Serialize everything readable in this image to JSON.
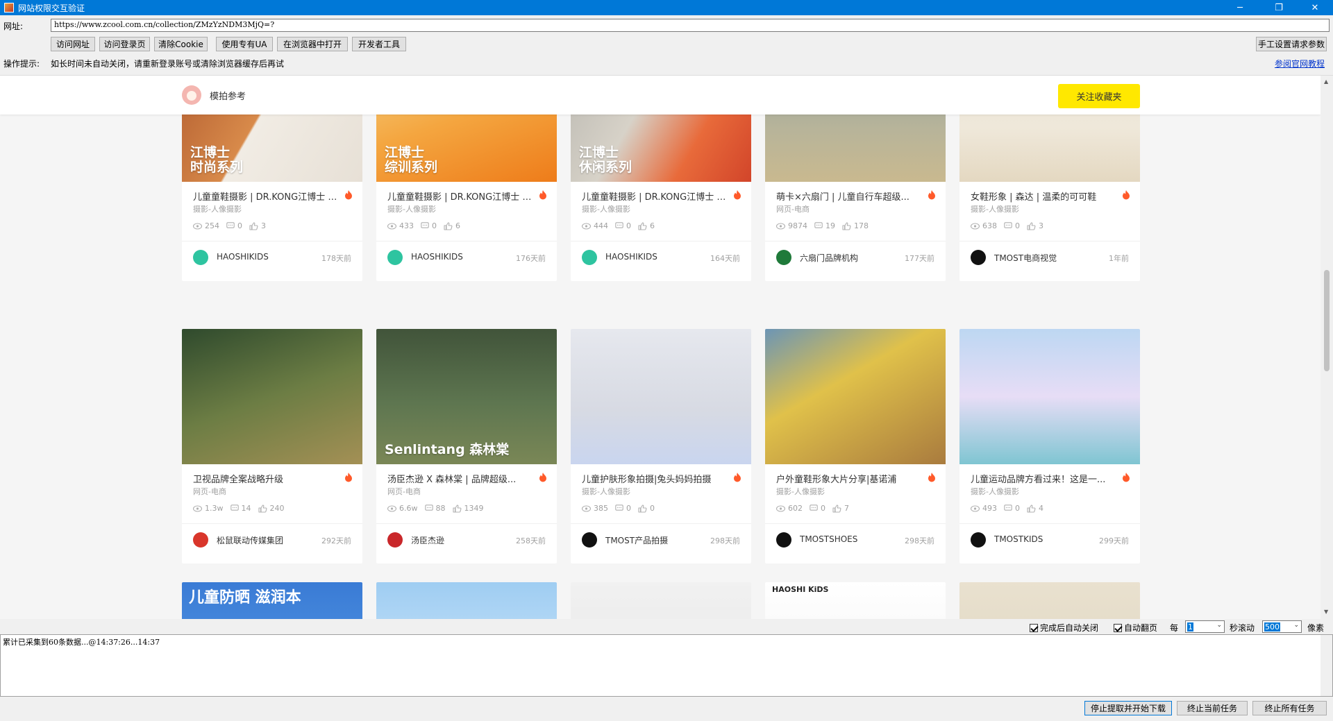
{
  "window": {
    "title": "网站权限交互验证",
    "controls": {
      "minimize": "─",
      "maximize": "❐",
      "close": "✕"
    }
  },
  "url_bar": {
    "label": "网址:",
    "value": "https://www.zcool.com.cn/collection/ZMzYzNDM3MjQ=?"
  },
  "toolbar": {
    "buttons": [
      "访问网址",
      "访问登录页",
      "清除Cookie",
      "使用专有UA",
      "在浏览器中打开",
      "开发者工具"
    ],
    "manual_settings": "手工设置请求参数"
  },
  "hint": {
    "label": "操作提示:",
    "text": "如长时间未自动关闭，请重新登录账号或清除浏览器缓存后再试",
    "link": "参阅官网教程"
  },
  "collection": {
    "name": "模拍参考",
    "follow_label": "关注收藏夹"
  },
  "cards_row1": [
    {
      "thumb_text": "江博士\n时尚系列",
      "title": "儿童童鞋摄影 | DR.KONG江博士 时尚系列",
      "category": "摄影-人像摄影",
      "views": "254",
      "comments": "0",
      "likes": "3",
      "author": "HAOSHIKIDS",
      "time": "178天前"
    },
    {
      "thumb_text": "江博士\n综训系列",
      "title": "儿童童鞋摄影 | DR.KONG江博士 综训系列",
      "category": "摄影-人像摄影",
      "views": "433",
      "comments": "0",
      "likes": "6",
      "author": "HAOSHIKIDS",
      "time": "176天前"
    },
    {
      "thumb_text": "江博士\n休闲系列",
      "title": "儿童童鞋摄影 | DR.KONG江博士 休闲系列",
      "category": "摄影-人像摄影",
      "views": "444",
      "comments": "0",
      "likes": "6",
      "author": "HAOSHIKIDS",
      "time": "164天前"
    },
    {
      "thumb_text": "",
      "title": "萌卡×六扇门 | 儿童自行车超级...",
      "category": "网页-电商",
      "views": "9874",
      "comments": "19",
      "likes": "178",
      "author": "六扇门品牌机构",
      "time": "177天前"
    },
    {
      "thumb_text": "",
      "title": "女鞋形象 | 森达 | 温柔的可可鞋",
      "category": "摄影-人像摄影",
      "views": "638",
      "comments": "0",
      "likes": "3",
      "author": "TMOST电商视觉",
      "time": "1年前"
    }
  ],
  "cards_row2": [
    {
      "thumb_text": "",
      "title": "卫视品牌全案战略升级",
      "category": "网页-电商",
      "views": "1.3w",
      "comments": "14",
      "likes": "240",
      "author": "松鼠联动传媒集团",
      "time": "292天前"
    },
    {
      "thumb_text": "Senlintang 森林棠",
      "title": "汤臣杰逊 X 森林棠 | 品牌超级...",
      "category": "网页-电商",
      "views": "6.6w",
      "comments": "88",
      "likes": "1349",
      "author": "汤臣杰逊",
      "time": "258天前"
    },
    {
      "thumb_text": "",
      "title": "儿童护肤形象拍摄|兔头妈妈拍摄",
      "category": "摄影-人像摄影",
      "views": "385",
      "comments": "0",
      "likes": "0",
      "author": "TMOST产品拍摄",
      "time": "298天前"
    },
    {
      "thumb_text": "",
      "title": "户外童鞋形象大片分享|基诺浦",
      "category": "摄影-人像摄影",
      "views": "602",
      "comments": "0",
      "likes": "7",
      "author": "TMOSTSHOES",
      "time": "298天前"
    },
    {
      "thumb_text": "",
      "title": "儿童运动品牌方看过来！这是一...",
      "category": "摄影-人像摄影",
      "views": "493",
      "comments": "0",
      "likes": "4",
      "author": "TMOSTKIDS",
      "time": "299天前"
    }
  ],
  "cards_row3_partial": [
    "儿童防晒 滋润本",
    "",
    "",
    "HAOSHI KiDS",
    ""
  ],
  "controls": {
    "auto_close": "完成后自动关闭",
    "auto_page": "自动翻页",
    "every": "每",
    "seconds": "1",
    "scroll_label": "秒滚动",
    "pixels": "500",
    "pixel_unit": "像素"
  },
  "log": {
    "text": "累计已采集到60条数据...@14:37:26...14:37"
  },
  "actions": {
    "stop_download": "停止提取并开始下载",
    "stop_current": "终止当前任务",
    "stop_all": "终止所有任务"
  },
  "colors": {
    "accent": "#0078d7",
    "follow": "#ffe800",
    "flame": "#ff5a2a"
  }
}
